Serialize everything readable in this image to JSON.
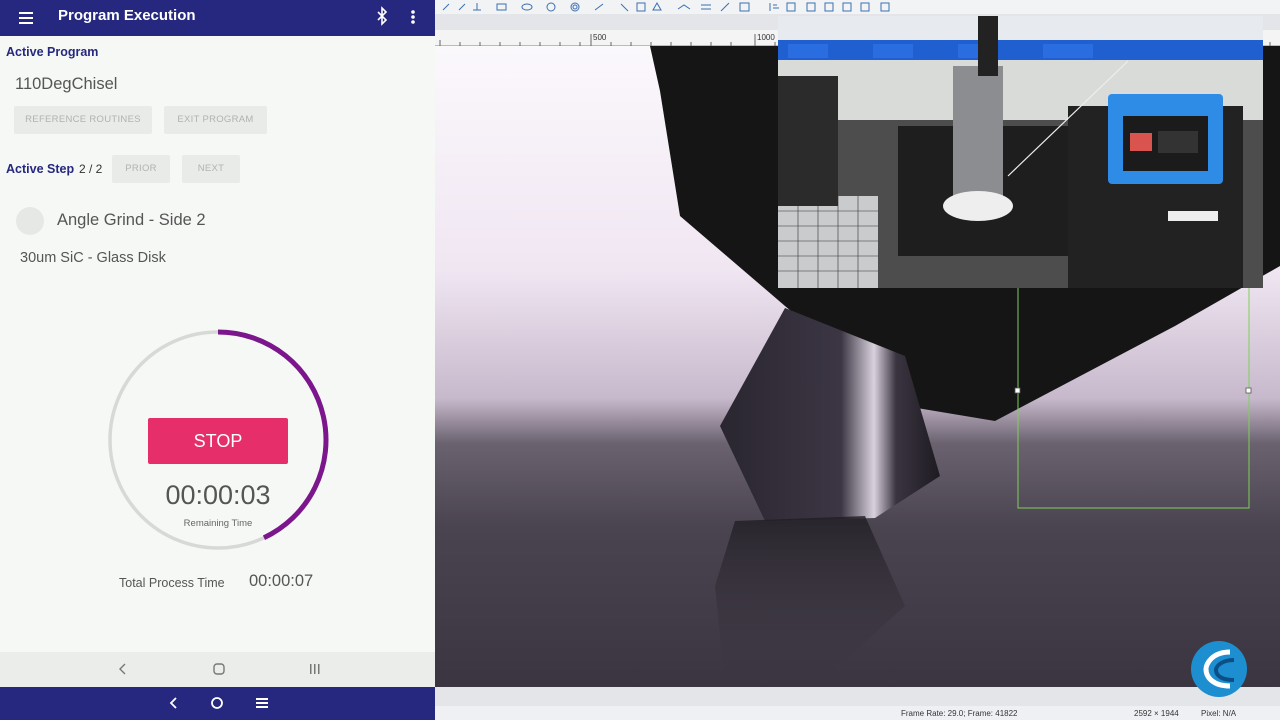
{
  "app": {
    "title": "Program Execution",
    "icons": {
      "menu": "hamburger-icon",
      "bluetooth": "bluetooth-icon",
      "more": "more-vert-icon"
    },
    "colors": {
      "primary": "#26287f",
      "accent": "#e62e6b",
      "progress": "#7b168c"
    }
  },
  "active_program": {
    "label": "Active Program",
    "name": "110DegChisel",
    "buttons": {
      "reference_routines": "REFERENCE ROUTINES",
      "exit_program": "EXIT PROGRAM"
    }
  },
  "active_step": {
    "label": "Active Step",
    "count": "2 / 2",
    "buttons": {
      "prior": "PRIOR",
      "next": "NEXT"
    },
    "name": "Angle Grind - Side 2",
    "abrasive": "30um SiC - Glass Disk"
  },
  "timer": {
    "stop_label": "STOP",
    "remaining": "00:00:03",
    "remaining_label": "Remaining Time",
    "progress_fraction": 0.43,
    "total_label": "Total Process Time",
    "total": "00:00:07"
  },
  "system_nav": {
    "icons": [
      "back-icon",
      "home-icon",
      "recents-icon"
    ]
  },
  "scope": {
    "ruler": {
      "ticks": [
        "500",
        "1000"
      ]
    },
    "status": {
      "frame_info": "Frame Rate: 29.0; Frame: 41822",
      "resolution": "2592 × 1944",
      "pixel": "Pixel: N/A"
    }
  }
}
